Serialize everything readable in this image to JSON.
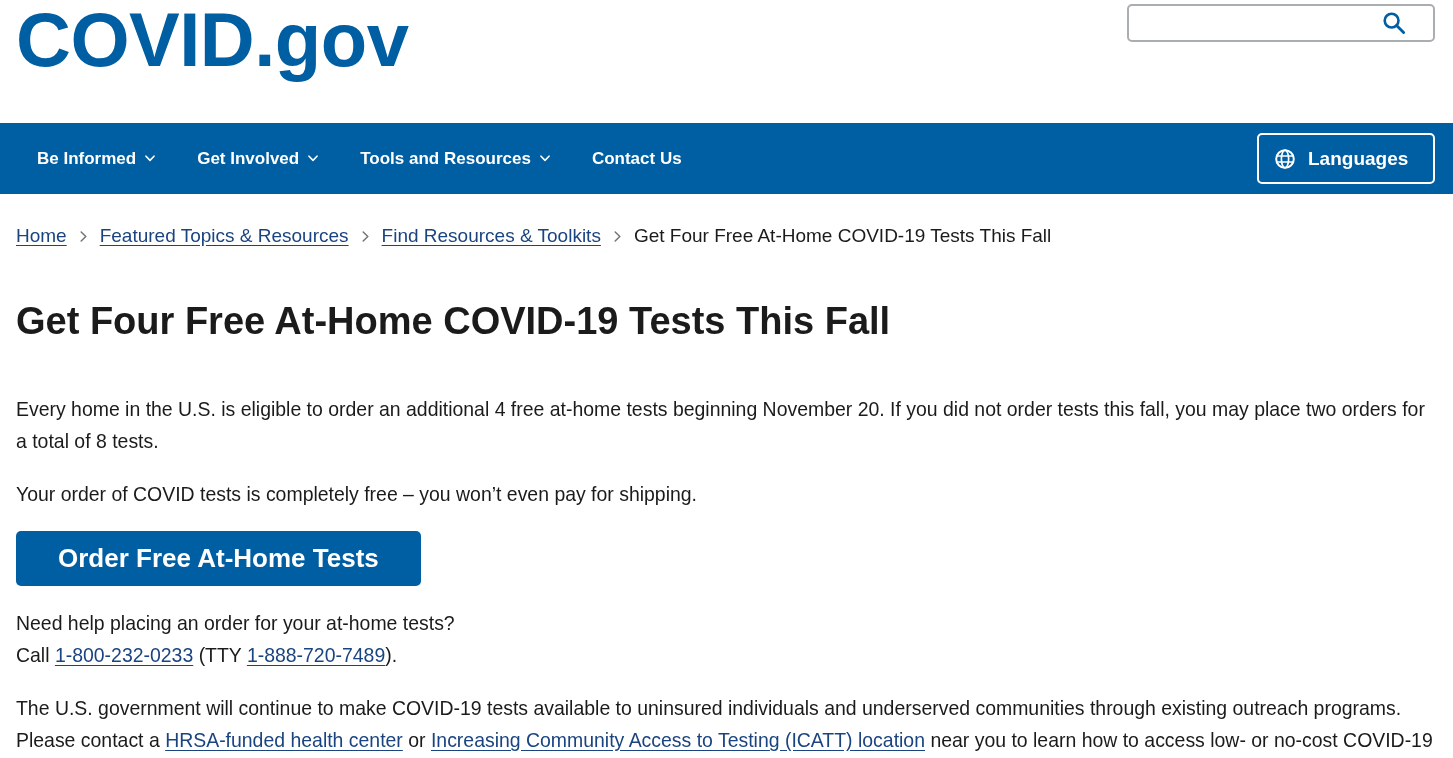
{
  "header": {
    "logo": "COVID.gov"
  },
  "nav": {
    "items": [
      {
        "label": "Be Informed",
        "has_menu": true
      },
      {
        "label": "Get Involved",
        "has_menu": true
      },
      {
        "label": "Tools and Resources",
        "has_menu": true
      },
      {
        "label": "Contact Us",
        "has_menu": false
      }
    ],
    "languages_button": "Languages"
  },
  "breadcrumb": [
    {
      "label": "Home",
      "kind": "link"
    },
    {
      "label": "Featured Topics & Resources",
      "kind": "link"
    },
    {
      "label": "Find Resources & Toolkits",
      "kind": "link"
    },
    {
      "label": "Get Four Free At-Home COVID-19 Tests This Fall",
      "kind": "current"
    }
  ],
  "page_title": "Get Four Free At-Home COVID-19 Tests This Fall",
  "content": [
    {
      "kind": "paragraph",
      "lines": [
        [
          {
            "kind": "text",
            "text": "Every home in the U.S. is eligible to order an additional 4 free at-home tests beginning November 20. If you did not order tests this fall, you may place two orders for a total of 8 tests."
          }
        ]
      ]
    },
    {
      "kind": "paragraph",
      "lines": [
        [
          {
            "kind": "text",
            "text": "Your order of COVID tests is completely free – you won’t even pay for shipping."
          }
        ]
      ]
    },
    {
      "kind": "button",
      "label": "Order Free At-Home Tests"
    },
    {
      "kind": "paragraph",
      "lines": [
        [
          {
            "kind": "text",
            "text": "Need help placing an order for your at-home tests?"
          }
        ],
        [
          {
            "kind": "text",
            "text": "Call "
          },
          {
            "kind": "link",
            "text": "1-800-232-0233"
          },
          {
            "kind": "text",
            "text": " (TTY "
          },
          {
            "kind": "link",
            "text": "1-888-720-7489"
          },
          {
            "kind": "text",
            "text": ")."
          }
        ]
      ]
    },
    {
      "kind": "paragraph",
      "lines": [
        [
          {
            "kind": "text",
            "text": "The U.S. government will continue to make COVID-19 tests available to uninsured individuals and underserved communities through existing outreach programs. Please contact a "
          },
          {
            "kind": "link",
            "text": "HRSA-funded health center"
          },
          {
            "kind": "text",
            "text": " or "
          },
          {
            "kind": "link",
            "text": "Increasing Community Access to Testing (ICATT) location"
          },
          {
            "kind": "text",
            "text": " near you to learn how to access low- or no-cost COVID-19"
          }
        ]
      ]
    }
  ]
}
